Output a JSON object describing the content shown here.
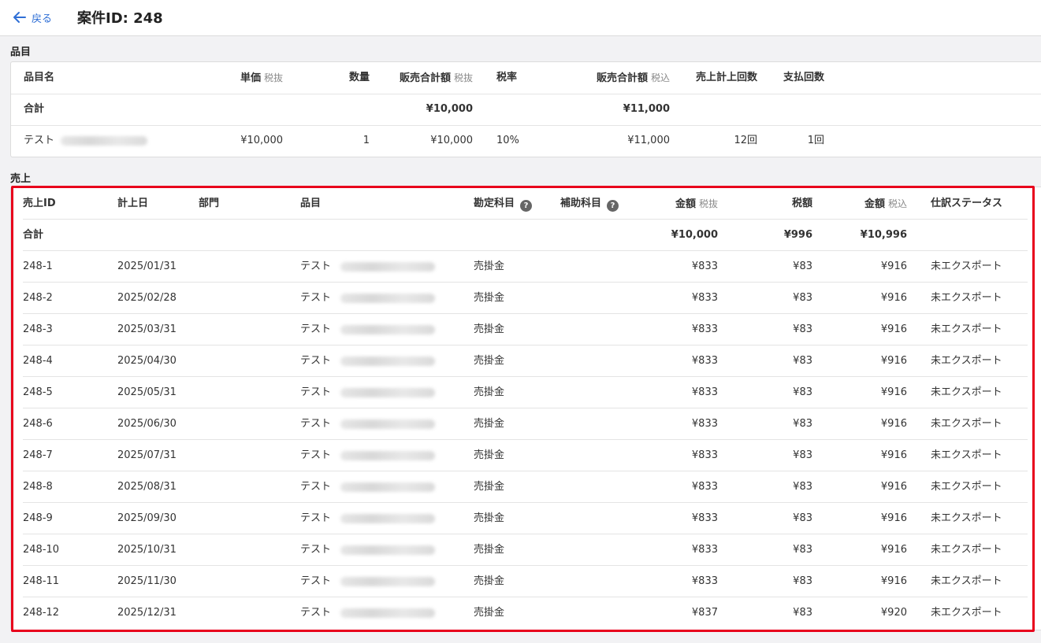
{
  "header": {
    "back_label": "戻る",
    "title": "案件ID: 248"
  },
  "items_section": {
    "label": "品目",
    "columns": {
      "name": "品目名",
      "unit_price": "単価",
      "unit_price_sub": "税抜",
      "quantity": "数量",
      "sales_total": "販売合計額",
      "sales_total_sub": "税抜",
      "tax_rate": "税率",
      "sales_total_incl": "販売合計額",
      "sales_total_incl_sub": "税込",
      "sales_count": "売上計上回数",
      "payment_count": "支払回数"
    },
    "total_row": {
      "label": "合計",
      "sales_total": "¥10,000",
      "sales_total_incl": "¥11,000"
    },
    "rows": [
      {
        "name": "テスト",
        "unit_price": "¥10,000",
        "quantity": "1",
        "sales_total": "¥10,000",
        "tax_rate": "10%",
        "sales_total_incl": "¥11,000",
        "sales_count": "12回",
        "payment_count": "1回"
      }
    ]
  },
  "sales_section": {
    "label": "売上",
    "columns": {
      "id": "売上ID",
      "date": "計上日",
      "department": "部門",
      "item": "品目",
      "account": "勘定科目",
      "sub_account": "補助科目",
      "amount": "金額",
      "amount_sub": "税抜",
      "tax": "税額",
      "amount_incl": "金額",
      "amount_incl_sub": "税込",
      "status": "仕訳ステータス"
    },
    "help_icon": "?",
    "total_row": {
      "label": "合計",
      "amount": "¥10,000",
      "tax": "¥996",
      "amount_incl": "¥10,996"
    },
    "rows": [
      {
        "id": "248-1",
        "date": "2025/01/31",
        "item": "テスト",
        "account": "売掛金",
        "amount": "¥833",
        "tax": "¥83",
        "amount_incl": "¥916",
        "status": "未エクスポート"
      },
      {
        "id": "248-2",
        "date": "2025/02/28",
        "item": "テスト",
        "account": "売掛金",
        "amount": "¥833",
        "tax": "¥83",
        "amount_incl": "¥916",
        "status": "未エクスポート"
      },
      {
        "id": "248-3",
        "date": "2025/03/31",
        "item": "テスト",
        "account": "売掛金",
        "amount": "¥833",
        "tax": "¥83",
        "amount_incl": "¥916",
        "status": "未エクスポート"
      },
      {
        "id": "248-4",
        "date": "2025/04/30",
        "item": "テスト",
        "account": "売掛金",
        "amount": "¥833",
        "tax": "¥83",
        "amount_incl": "¥916",
        "status": "未エクスポート"
      },
      {
        "id": "248-5",
        "date": "2025/05/31",
        "item": "テスト",
        "account": "売掛金",
        "amount": "¥833",
        "tax": "¥83",
        "amount_incl": "¥916",
        "status": "未エクスポート"
      },
      {
        "id": "248-6",
        "date": "2025/06/30",
        "item": "テスト",
        "account": "売掛金",
        "amount": "¥833",
        "tax": "¥83",
        "amount_incl": "¥916",
        "status": "未エクスポート"
      },
      {
        "id": "248-7",
        "date": "2025/07/31",
        "item": "テスト",
        "account": "売掛金",
        "amount": "¥833",
        "tax": "¥83",
        "amount_incl": "¥916",
        "status": "未エクスポート"
      },
      {
        "id": "248-8",
        "date": "2025/08/31",
        "item": "テスト",
        "account": "売掛金",
        "amount": "¥833",
        "tax": "¥83",
        "amount_incl": "¥916",
        "status": "未エクスポート"
      },
      {
        "id": "248-9",
        "date": "2025/09/30",
        "item": "テスト",
        "account": "売掛金",
        "amount": "¥833",
        "tax": "¥83",
        "amount_incl": "¥916",
        "status": "未エクスポート"
      },
      {
        "id": "248-10",
        "date": "2025/10/31",
        "item": "テスト",
        "account": "売掛金",
        "amount": "¥833",
        "tax": "¥83",
        "amount_incl": "¥916",
        "status": "未エクスポート"
      },
      {
        "id": "248-11",
        "date": "2025/11/30",
        "item": "テスト",
        "account": "売掛金",
        "amount": "¥833",
        "tax": "¥83",
        "amount_incl": "¥916",
        "status": "未エクスポート"
      },
      {
        "id": "248-12",
        "date": "2025/12/31",
        "item": "テスト",
        "account": "売掛金",
        "amount": "¥837",
        "tax": "¥83",
        "amount_incl": "¥920",
        "status": "未エクスポート"
      }
    ]
  },
  "colors": {
    "accent": "#2f6fd6",
    "highlight": "#e8001c",
    "background": "#f2f2f4"
  }
}
